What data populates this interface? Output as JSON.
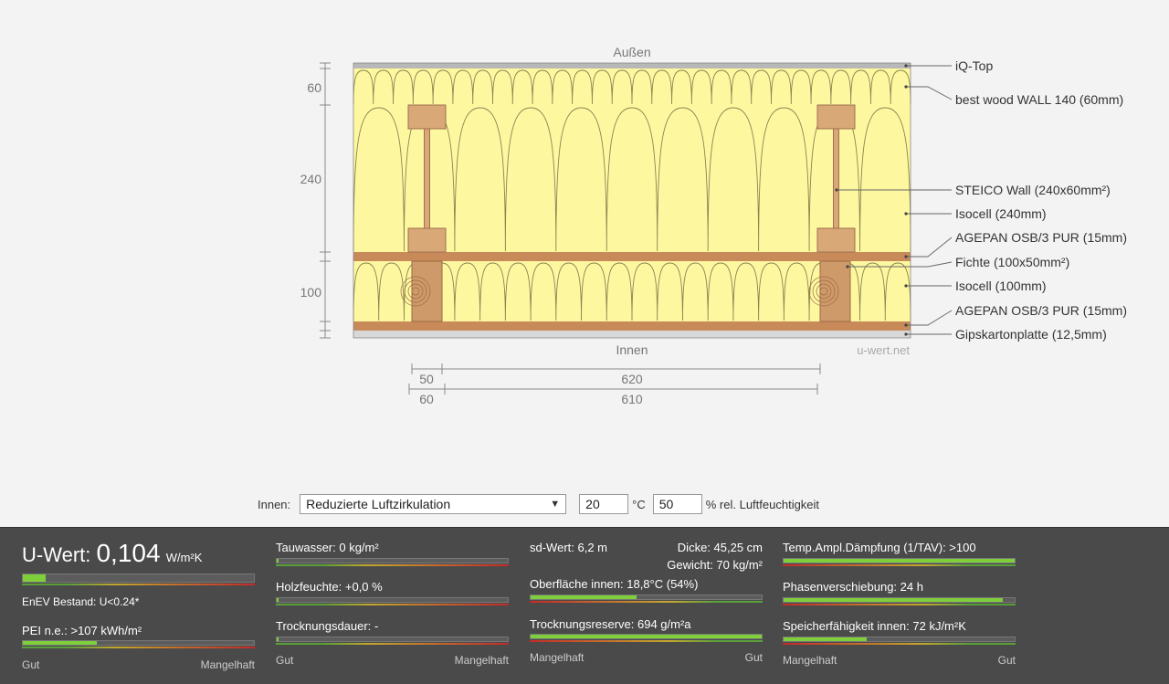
{
  "diagram": {
    "outside_label": "Außen",
    "inside_label": "Innen",
    "watermark": "u-wert.net",
    "left_dims": [
      "60",
      "240",
      "100"
    ],
    "bottom_dims_top": [
      "50",
      "620"
    ],
    "bottom_dims_bottom": [
      "60",
      "610"
    ],
    "layer_labels": [
      "iQ-Top",
      "best wood WALL 140 (60mm)",
      "STEICO  Wall (240x60mm²)",
      "Isocell (240mm)",
      "AGEPAN OSB/3 PUR (15mm)",
      "Fichte (100x50mm²)",
      "Isocell (100mm)",
      "AGEPAN OSB/3 PUR (15mm)",
      "Gipskartonplatte (12,5mm)"
    ],
    "colors": {
      "insulation": "#fdf8a0",
      "wood": "#d9a877",
      "osb": "#c98a5a",
      "gips": "#d8d8d8"
    }
  },
  "controls": {
    "inside_label": "Innen:",
    "select_value": "Reduzierte Luftzirkulation",
    "temp_value": "20",
    "temp_unit": "°C",
    "humidity_value": "50",
    "humidity_unit": "% rel. Luftfeuchtigkeit"
  },
  "results": {
    "uwert": {
      "prefix": "U-Wert: ",
      "value": "0,104",
      "unit": "W/m²K",
      "fill": 0.1
    },
    "enev": "EnEV Bestand: U<0.24*",
    "pei": {
      "title": "PEI n.e.: >107 kWh/m²",
      "fill": 0.32
    },
    "col1_scale": [
      "Gut",
      "Mangelhaft"
    ],
    "tauwasser": {
      "title": "Tauwasser: 0 kg/m²",
      "fill": 0.0
    },
    "holzfeuchte": {
      "title": "Holzfeuchte: +0,0 %",
      "fill": 0.0
    },
    "trocknungsdauer": {
      "title": "Trocknungsdauer: -",
      "fill": 0.0
    },
    "col2_scale": [
      "Gut",
      "Mangelhaft"
    ],
    "sd_wert": "sd-Wert: 6,2 m",
    "dicke": "Dicke: 45,25 cm",
    "gewicht": "Gewicht: 70 kg/m²",
    "oberflaeche": {
      "title": "Oberfläche innen: 18,8°C (54%)",
      "fill": 0.46
    },
    "trocknungsreserve": {
      "title": "Trocknungsreserve: 694 g/m²a",
      "fill": 1.0
    },
    "col3_scale": [
      "Mangelhaft",
      "Gut"
    ],
    "temp_ampl": {
      "title": "Temp.Ampl.Dämpfung (1/TAV): >100",
      "fill": 1.0
    },
    "phasen": {
      "title": "Phasenverschiebung: 24 h",
      "fill": 0.95
    },
    "speicher": {
      "title": "Speicherfähigkeit innen: 72 kJ/m²K",
      "fill": 0.36
    },
    "col4_scale": [
      "Mangelhaft",
      "Gut"
    ]
  }
}
